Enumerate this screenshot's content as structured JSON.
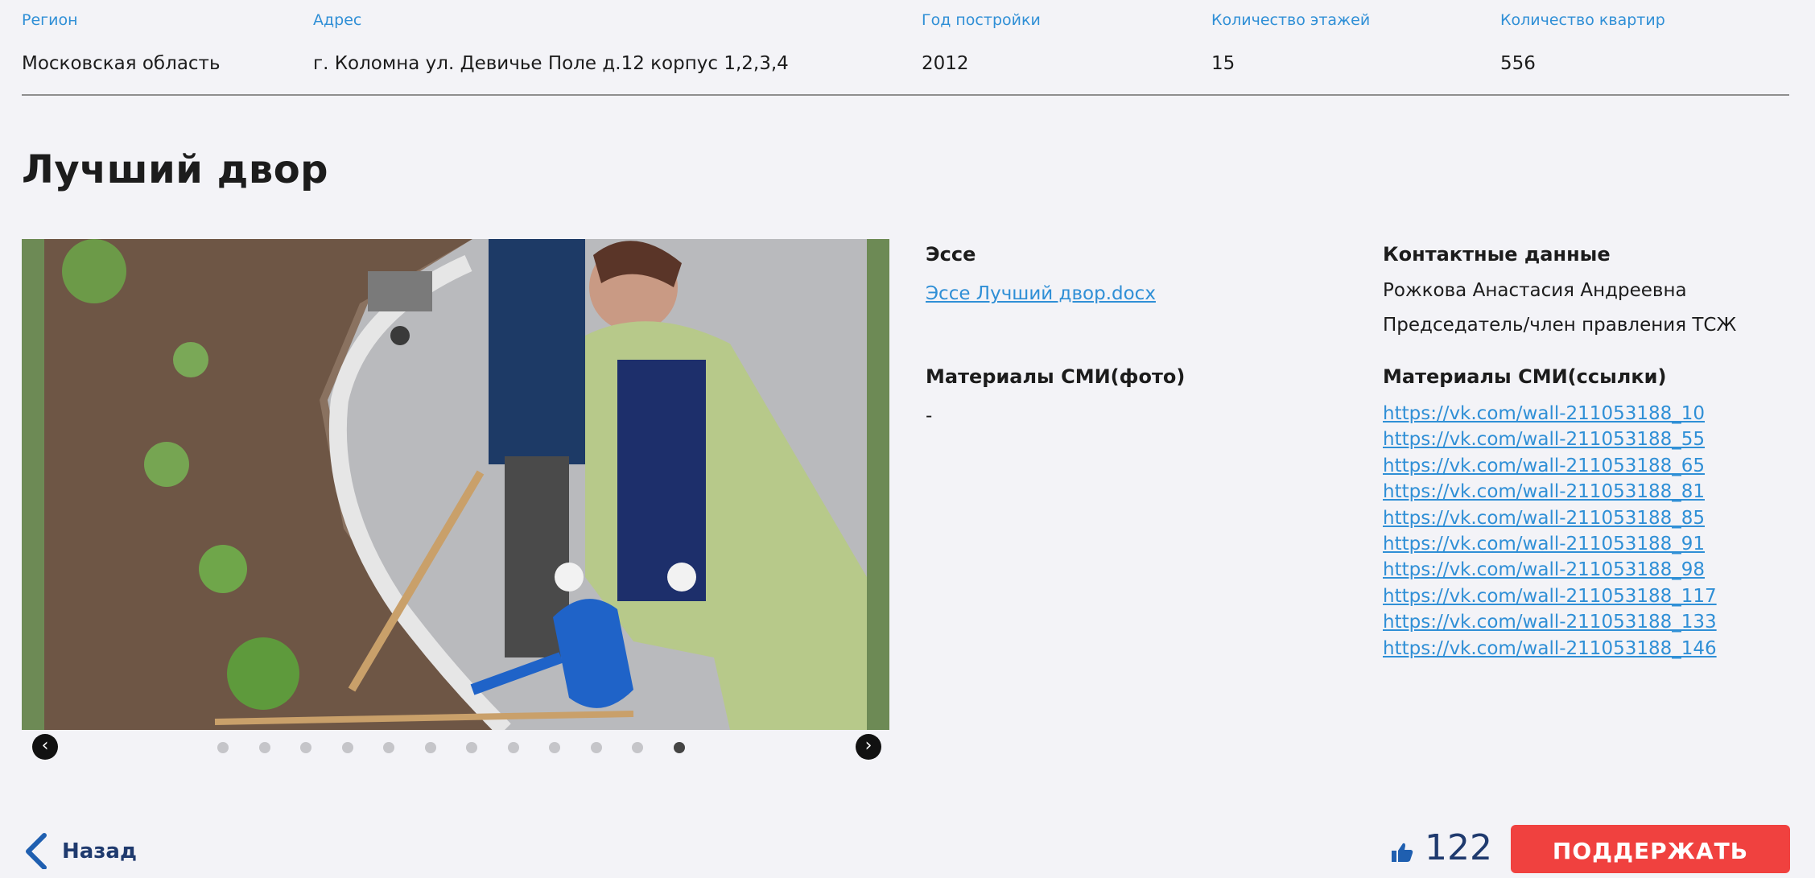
{
  "info": {
    "region": {
      "label": "Регион",
      "value": "Московская область"
    },
    "address": {
      "label": "Адрес",
      "value": "г. Коломна ул. Девичье Поле д.12 корпус 1,2,3,4"
    },
    "year": {
      "label": "Год постройки",
      "value": "2012"
    },
    "floors": {
      "label": "Количество этажей",
      "value": "15"
    },
    "apartments": {
      "label": "Количество квартир",
      "value": "556"
    }
  },
  "page_title": "Лучший двор",
  "slider": {
    "prev_icon": "chevron-left-icon",
    "next_icon": "chevron-right-icon",
    "dot_count": 12,
    "active_index": 11
  },
  "essay": {
    "title": "Эссе",
    "link": "Эссе Лучший двор.docx"
  },
  "contacts": {
    "title": "Контактные данные",
    "name": "Рожкова Анастасия Андреевна",
    "role": "Председатель/член правления ТСЖ"
  },
  "media_photo": {
    "title": "Материалы СМИ(фото)",
    "value": "-"
  },
  "media_links": {
    "title": "Материалы СМИ(ссылки)",
    "links": [
      "https://vk.com/wall-211053188_10",
      "https://vk.com/wall-211053188_55",
      "https://vk.com/wall-211053188_65",
      "https://vk.com/wall-211053188_81",
      "https://vk.com/wall-211053188_85",
      "https://vk.com/wall-211053188_91",
      "https://vk.com/wall-211053188_98",
      "https://vk.com/wall-211053188_117",
      "https://vk.com/wall-211053188_133",
      "https://vk.com/wall-211053188_146"
    ]
  },
  "footer": {
    "back_label": "Назад",
    "like_icon": "thumbs-up-icon",
    "likes": "122",
    "support_label": "ПОДДЕРЖАТЬ"
  },
  "colors": {
    "accent_blue": "#2f8fd6",
    "support_red": "#f0413f",
    "dark_blue": "#1f3a6e"
  }
}
